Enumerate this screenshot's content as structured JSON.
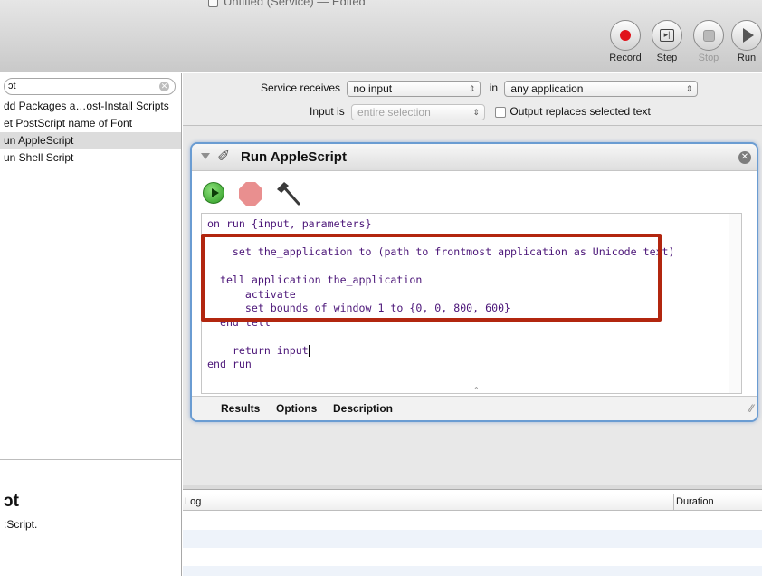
{
  "window": {
    "title": "Untitled (Service) — Edited"
  },
  "toolbar": {
    "record_label": "Record",
    "step_label": "Step",
    "stop_label": "Stop",
    "run_label": "Run"
  },
  "library": {
    "search_value": "ɔt",
    "actions": [
      {
        "label": "dd Packages a…ost-Install Scripts",
        "selected": false
      },
      {
        "label": "et PostScript name of Font",
        "selected": false
      },
      {
        "label": "un AppleScript",
        "selected": true
      },
      {
        "label": "un Shell Script",
        "selected": false
      }
    ],
    "description_title": "ɔt",
    "description_text": ":Script."
  },
  "service": {
    "receives_label": "Service receives",
    "receives_value": "no input",
    "in_label": "in",
    "app_value": "any application",
    "input_is_label": "Input is",
    "input_is_value": "entire selection",
    "output_replaces_label": "Output replaces selected text"
  },
  "action": {
    "title": "Run AppleScript",
    "code_lines": [
      "on run {input, parameters}",
      "",
      "    set the_application to (path to frontmost application as Unicode text)",
      "",
      "  tell application the_application",
      "      activate",
      "      set bounds of window 1 to {0, 0, 800, 600}",
      "  end tell",
      "",
      "    return input",
      "end run"
    ],
    "tabs": [
      "Results",
      "Options",
      "Description"
    ]
  },
  "log": {
    "log_col": "Log",
    "duration_col": "Duration"
  },
  "colors": {
    "highlight_border": "#b2260f",
    "code_text": "#4b1578",
    "card_border": "#6a9cd2",
    "record_dot": "#e0131a"
  }
}
